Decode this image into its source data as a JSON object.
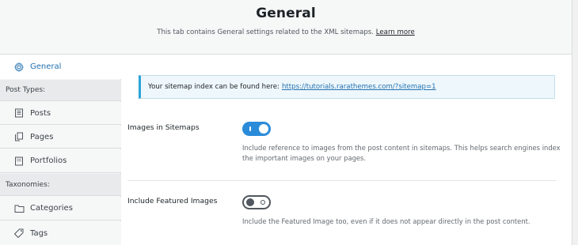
{
  "header": {
    "title": "General",
    "description": "This tab contains General settings related to the XML sitemaps.",
    "learn_more": "Learn more"
  },
  "sidebar": {
    "items": [
      {
        "label": "General",
        "icon": "gear-icon",
        "active": true
      },
      {
        "label": "Post Types:",
        "heading": true
      },
      {
        "label": "Posts",
        "icon": "post-icon"
      },
      {
        "label": "Pages",
        "icon": "page-icon"
      },
      {
        "label": "Portfolios",
        "icon": "portfolio-icon"
      },
      {
        "label": "Taxonomies:",
        "heading": true
      },
      {
        "label": "Categories",
        "icon": "folder-icon"
      },
      {
        "label": "Tags",
        "icon": "tag-icon"
      }
    ]
  },
  "main": {
    "notice_text": "Your sitemap index can be found here:",
    "notice_link": "https://tutorials.rarathemes.com/?sitemap=1",
    "settings": [
      {
        "label": "Images in Sitemaps",
        "enabled": true,
        "description": "Include reference to images from the post content in sitemaps. This helps search engines index the important images on your pages."
      },
      {
        "label": "Include Featured Images",
        "enabled": false,
        "description": "Include the Featured Image too, even if it does not appear directly in the post content."
      }
    ]
  },
  "colors": {
    "accent": "#2271b1",
    "toggle_on": "#2a8bd9",
    "notice_border": "#2ea3d9"
  }
}
